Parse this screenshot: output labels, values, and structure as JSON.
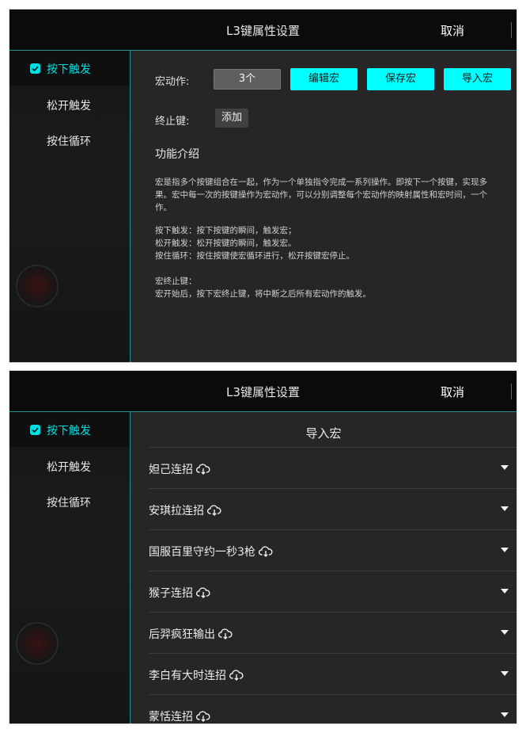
{
  "screen1": {
    "header": {
      "title": "L3键属性设置",
      "cancel": "取消"
    },
    "sidebar": {
      "items": [
        {
          "label": "按下触发"
        },
        {
          "label": "松开触发"
        },
        {
          "label": "按住循环"
        }
      ]
    },
    "macro_action_label": "宏动作:",
    "macro_count": "3个",
    "buttons": {
      "edit": "编辑宏",
      "save": "保存宏",
      "import": "导入宏"
    },
    "stop_key_label": "终止键:",
    "add_label": "添加",
    "intro": {
      "title": "功能介绍",
      "para1": [
        "宏是指多个按键组合在一起，作为一个单独指令完成一系列操作。即按下一个按键，实现多",
        "果。宏中每一次的按键操作为宏动作，可以分别调整每个宏动作的映射属性和宏时间，一个",
        "作。"
      ],
      "para2": [
        "按下触发：按下按键的瞬间，触发宏；",
        "松开触发：松开按键的瞬间，触发宏。",
        "按住循环：按住按键使宏循环进行，松开按键宏停止。"
      ],
      "para3": [
        "宏终止键：",
        "宏开始后，按下宏终止键，将中断之后所有宏动作的触发。"
      ]
    }
  },
  "screen2": {
    "header": {
      "title": "L3键属性设置",
      "cancel": "取消"
    },
    "sidebar": {
      "items": [
        {
          "label": "按下触发"
        },
        {
          "label": "松开触发"
        },
        {
          "label": "按住循环"
        }
      ]
    },
    "import_title": "导入宏",
    "macros": [
      {
        "name": "妲己连招"
      },
      {
        "name": "安琪拉连招"
      },
      {
        "name": "国服百里守约一秒3枪"
      },
      {
        "name": "猴子连招"
      },
      {
        "name": "后羿疯狂输出"
      },
      {
        "name": "李白有大时连招"
      },
      {
        "name": "蒙恬连招"
      }
    ]
  },
  "colors": {
    "accent": "#00e0e0",
    "button_cyan": "#00ffff",
    "panel": "#262626",
    "sidebar": "#181818"
  },
  "icons": {
    "check": "check-icon",
    "cloud": "cloud-download-icon",
    "dropdown": "chevron-down-icon"
  }
}
